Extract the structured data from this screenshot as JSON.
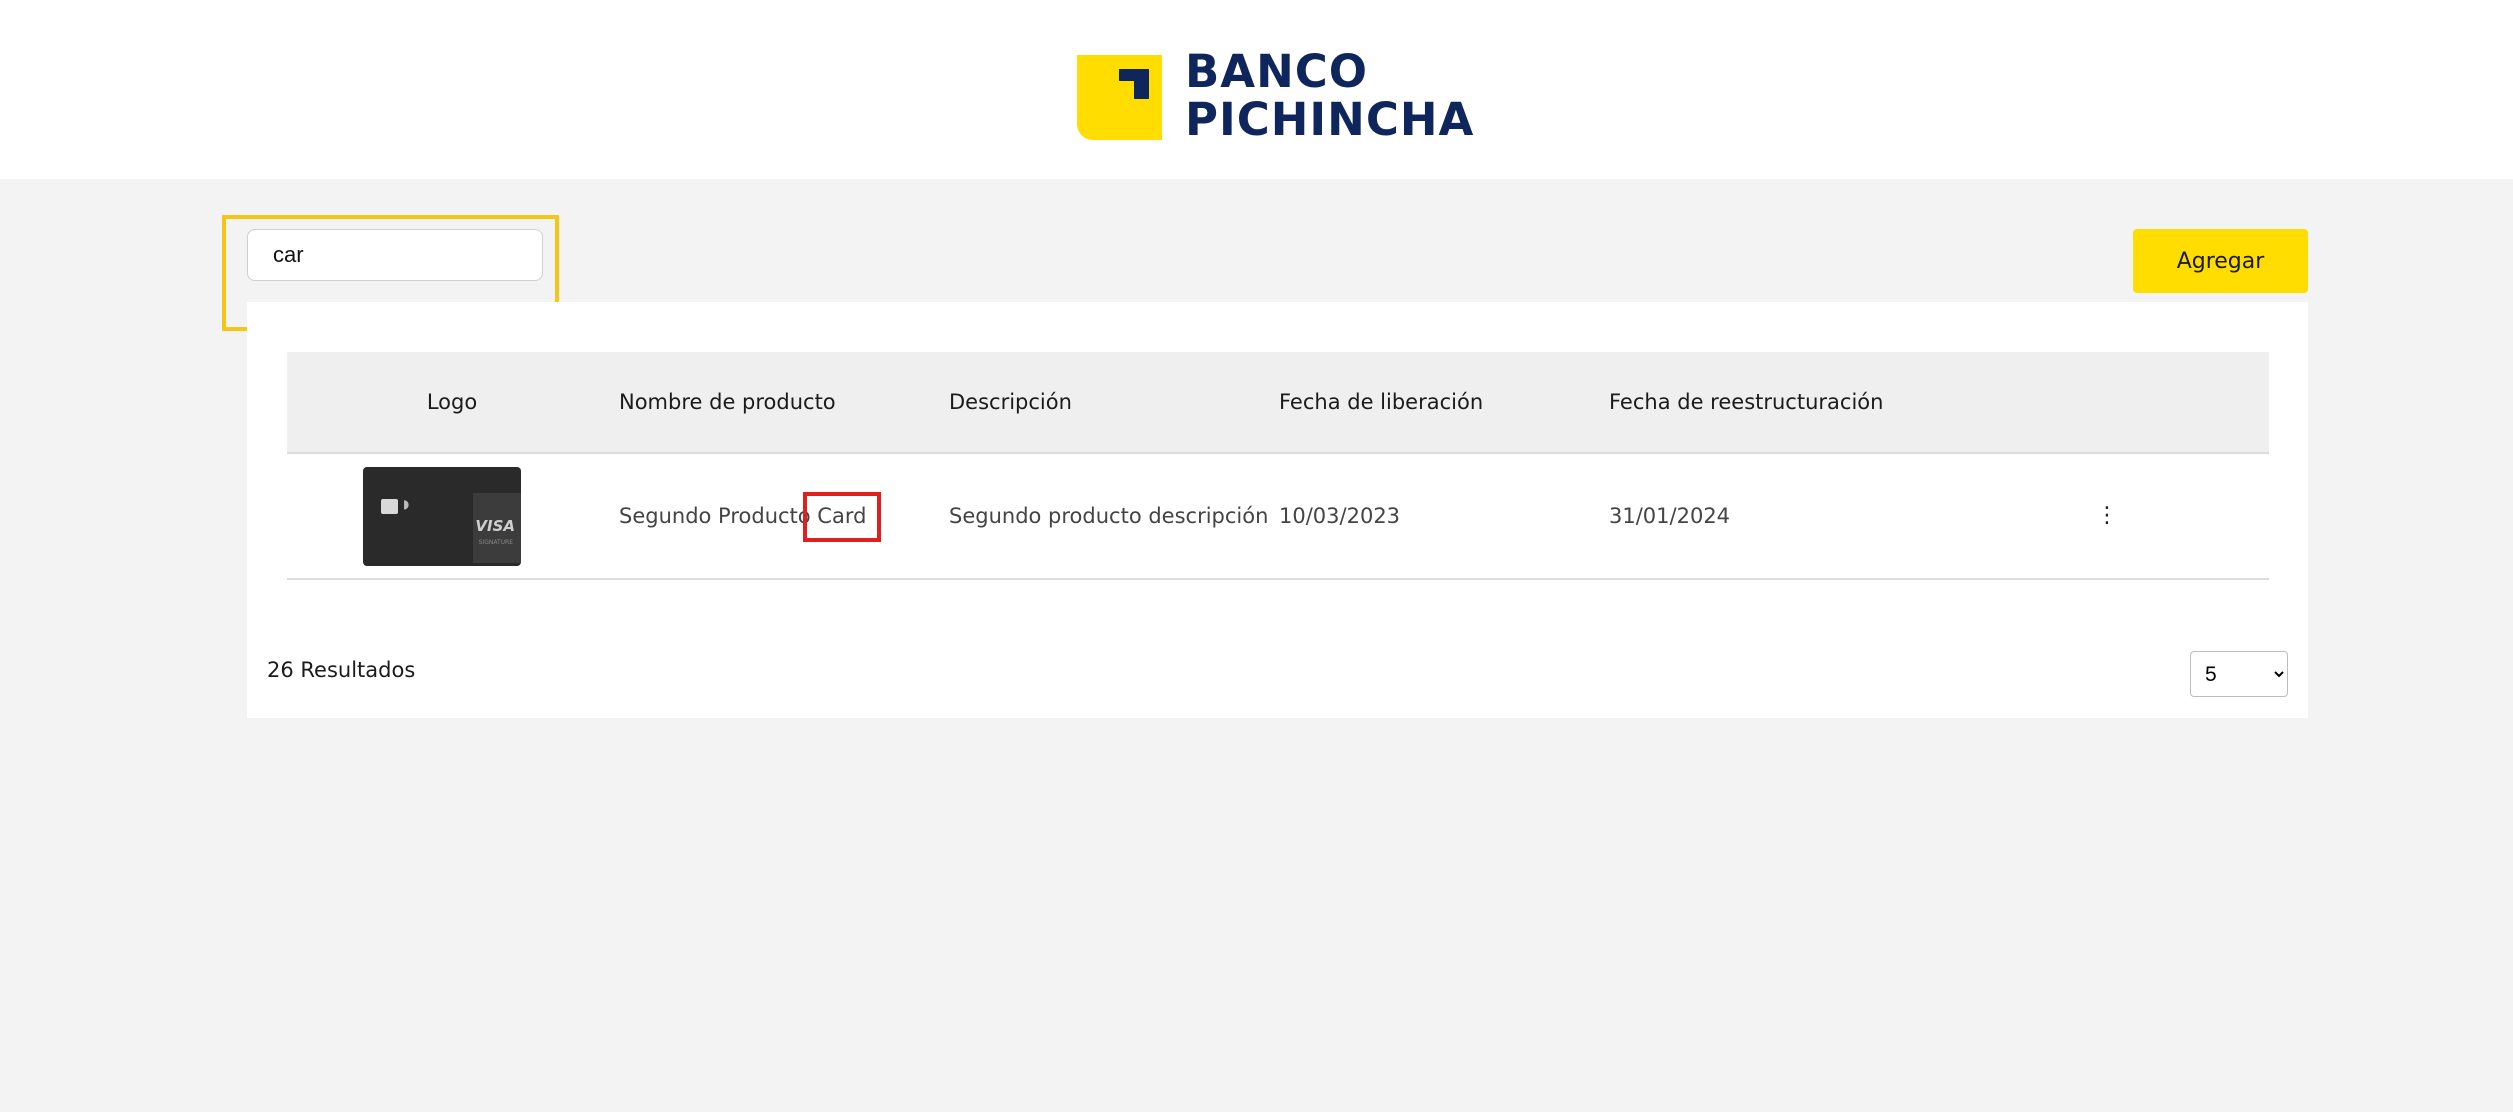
{
  "header": {
    "logo_line1": "BANCO",
    "logo_line2": "PICHINCHA"
  },
  "toolbar": {
    "search_value": "car",
    "add_label": "Agregar"
  },
  "table": {
    "columns": [
      "Logo",
      "Nombre de producto",
      "Descripción",
      "Fecha de liberación",
      "Fecha de reestructuración"
    ],
    "rows": [
      {
        "logo_icon": "credit-card-image",
        "name": "Segundo Producto Card",
        "description": "Segundo producto descripción",
        "release_date": "10/03/2023",
        "restructure_date": "31/01/2024",
        "menu_icon": "kebab-menu-icon"
      }
    ]
  },
  "footer": {
    "results_label": "26 Resultados",
    "page_size": "5",
    "page_size_options": [
      "5"
    ]
  },
  "colors": {
    "brand_yellow": "#ffdd00",
    "brand_navy": "#0f265c",
    "search_highlight": "#f5c518",
    "match_highlight": "#e02020"
  }
}
